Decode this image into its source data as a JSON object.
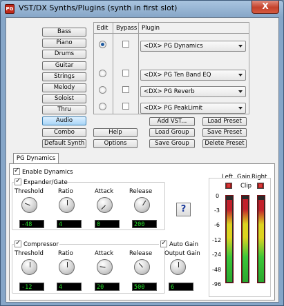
{
  "window": {
    "title": "VST/DX Synths/Plugins (synth in first slot)",
    "close_glyph": "X",
    "icon_label": "PG"
  },
  "instruments": [
    "Bass",
    "Piano",
    "Drums",
    "Guitar",
    "Strings",
    "Melody",
    "Soloist",
    "Thru",
    "Audio"
  ],
  "selected_instrument": "Audio",
  "left_buttons": {
    "combo": "Combo",
    "default_synth": "Default Synth"
  },
  "grid": {
    "headers": {
      "edit": "Edit",
      "bypass": "Bypass",
      "plugin": "Plugin"
    },
    "slots": [
      {
        "edit_selected": true,
        "bypass": false,
        "plugin": "<DX> PG Dynamics"
      },
      {
        "edit_selected": false,
        "bypass": false,
        "plugin": "<DX> PG Ten Band EQ"
      },
      {
        "edit_selected": false,
        "bypass": false,
        "plugin": "<DX> PG Reverb"
      },
      {
        "edit_selected": false,
        "bypass": false,
        "plugin": "<DX> PG PeakLimit"
      }
    ]
  },
  "actions": {
    "help": "Help",
    "options": "Options",
    "add_vst": "Add VST...",
    "load_group": "Load Group",
    "save_group": "Save Group",
    "load_preset": "Load Preset",
    "save_preset": "Save Preset",
    "delete_preset": "Delete Preset"
  },
  "tab": "PG Dynamics",
  "dynamics": {
    "enable_label": "Enable Dynamics",
    "enabled": true,
    "expander": {
      "label": "Expander/Gate",
      "enabled": true,
      "knobs": [
        {
          "label": "Threshold",
          "value": "-48",
          "level": 0.25
        },
        {
          "label": "Ratio",
          "value": "4",
          "level": 0.5
        },
        {
          "label": "Attack",
          "value": "0",
          "level": 0.0
        },
        {
          "label": "Release",
          "value": "200",
          "level": 0.62
        }
      ]
    },
    "help_glyph": "?",
    "compressor": {
      "label": "Compressor",
      "enabled": true,
      "knobs": [
        {
          "label": "Threshold",
          "value": "-12",
          "level": 0.5
        },
        {
          "label": "Ratio",
          "value": "4",
          "level": 0.5
        },
        {
          "label": "Attack",
          "value": "20",
          "level": 0.2
        },
        {
          "label": "Release",
          "value": "500",
          "level": 0.35
        }
      ]
    },
    "auto_gain": {
      "label": "Auto Gain",
      "enabled": true,
      "output_label": "Output Gain",
      "output_value": "6",
      "level": 0.5
    }
  },
  "meters": {
    "left_label": "Left",
    "gain_label": "Gain",
    "clip_label": "Clip",
    "right_label": "Right",
    "scale": [
      "0",
      "-3",
      "-6",
      "-12",
      "-24",
      "-48",
      "-96"
    ],
    "levels": {
      "left": 0.96,
      "gain": 0.97,
      "right": 0.96
    }
  }
}
